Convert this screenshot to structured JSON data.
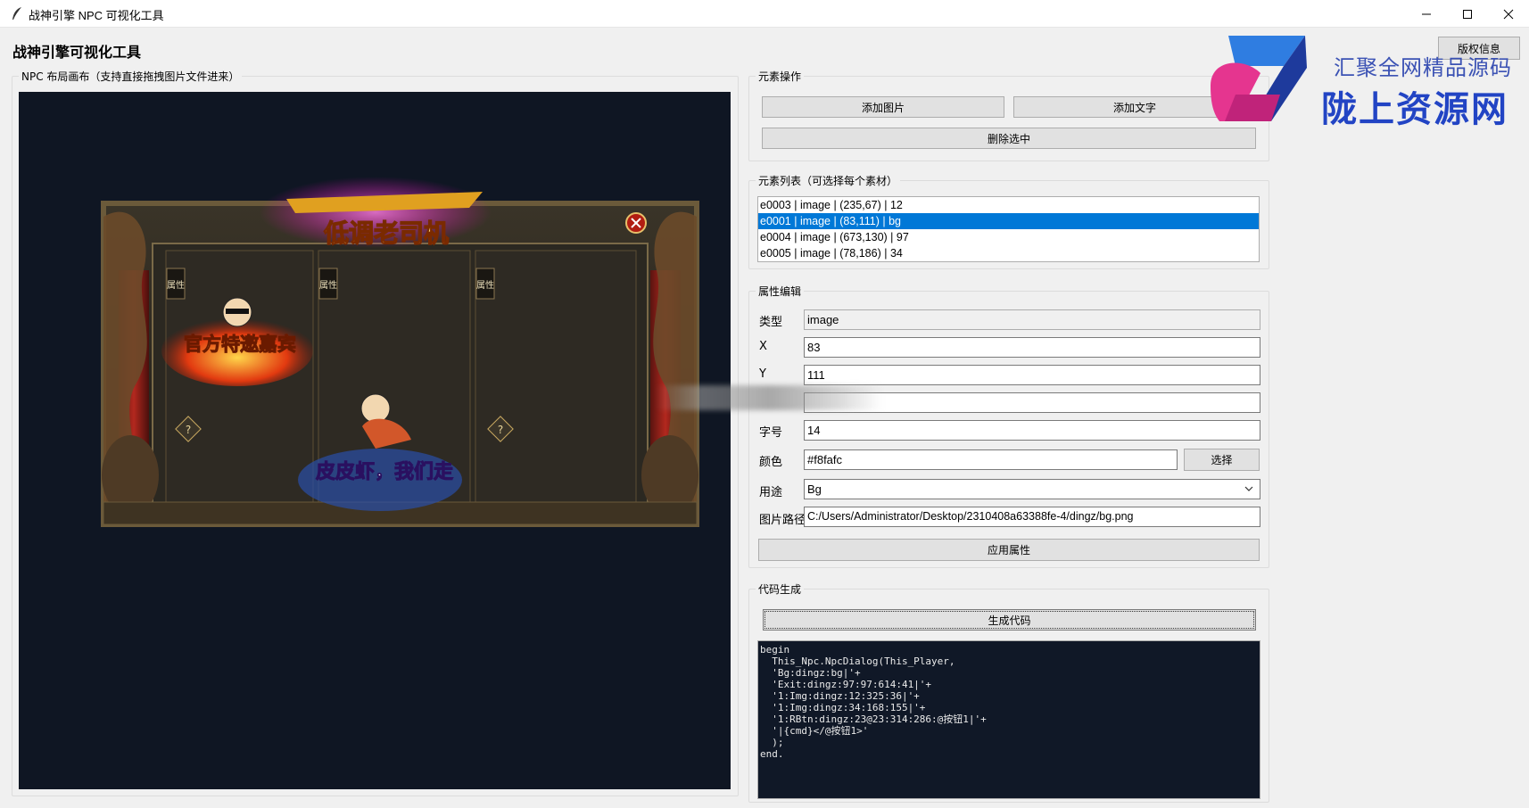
{
  "window": {
    "title": "战神引擎 NPC 可视化工具"
  },
  "heading": "战神引擎可视化工具",
  "copyright_button": "版权信息",
  "canvas_group": {
    "label": "NPC 布局画布（支持直接拖拽图片文件进来）"
  },
  "element_ops": {
    "label": "元素操作",
    "add_image": "添加图片",
    "add_text": "添加文字",
    "delete_selected": "删除选中"
  },
  "element_list": {
    "label": "元素列表（可选择每个素材）",
    "items": [
      {
        "text": "e0003 | image | (235,67) | 12",
        "selected": false
      },
      {
        "text": "e0001 | image | (83,111) | bg",
        "selected": true
      },
      {
        "text": "e0004 | image | (673,130) | 97",
        "selected": false
      },
      {
        "text": "e0005 | image | (78,186) | 34",
        "selected": false
      }
    ]
  },
  "props": {
    "label": "属性编辑",
    "type_label": "类型",
    "type_value": "image",
    "x_label": "X",
    "x_value": "83",
    "y_label": "Y",
    "y_value": "111",
    "text_value": "",
    "font_label": "字号",
    "font_value": "14",
    "color_label": "颜色",
    "color_value": "#f8fafc",
    "color_button": "选择",
    "use_label": "用途",
    "use_value": "Bg",
    "path_label": "图片路径",
    "path_value": "C:/Users/Administrator/Desktop/2310408a63388fe-4/dingz/bg.png",
    "apply_button": "应用属性"
  },
  "codegen": {
    "label": "代码生成",
    "generate_button": "生成代码",
    "code": "begin\n  This_Npc.NpcDialog(This_Player,\n  'Bg:dingz:bg|'+\n  'Exit:dingz:97:97:614:41|'+\n  '1:Img:dingz:12:325:36|'+\n  '1:Img:dingz:34:168:155|'+\n  '1:RBtn:dingz:23@23:314:286:@按钮1|'+\n  '|{cmd}</@按钮1>'\n  );\nend."
  },
  "npc_art": {
    "banner_top": "低调老司机",
    "banner_left": "官方特邀嘉宾",
    "banner_bottom": "皮皮虾，我们走",
    "column_tags": [
      "属性",
      "属性",
      "属性"
    ]
  },
  "watermark": {
    "line1": "汇聚全网精品源码",
    "line2": "陇上资源网"
  },
  "colors": {
    "accent": "#0078d7",
    "canvas_bg": "#0f1623",
    "code_bg": "#101827"
  }
}
